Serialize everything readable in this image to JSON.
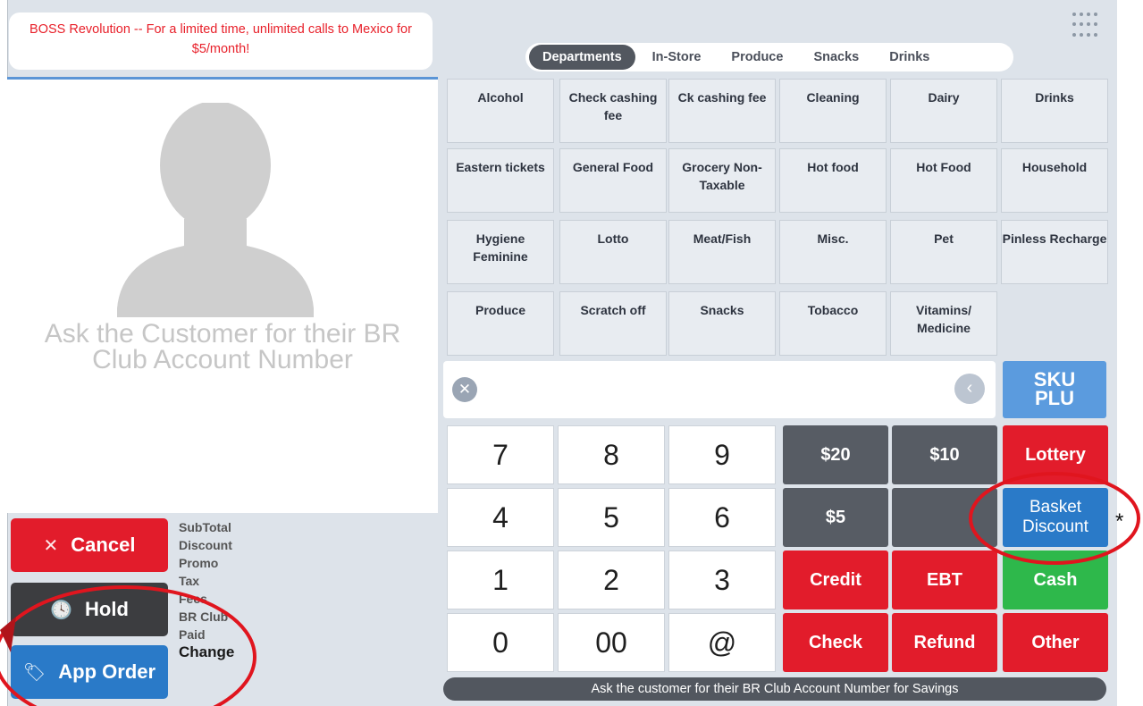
{
  "promo": {
    "text": "BOSS Revolution -- For a limited time, unlimited calls to Mexico for $5/month!"
  },
  "customer": {
    "prompt": "Ask the Customer for their BR Club Account Number"
  },
  "left_actions": {
    "cancel": "Cancel",
    "hold": "Hold",
    "app_order": "App Order"
  },
  "totals": {
    "labels": [
      "SubTotal",
      "Discount",
      "Promo",
      "Tax",
      "Fees",
      "BR Club",
      "Paid",
      "Change"
    ]
  },
  "tabs": [
    "Departments",
    "In-Store",
    "Produce",
    "Snacks",
    "Drinks"
  ],
  "departments": [
    "Alcohol",
    "Check cashing fee",
    "Ck cashing fee",
    "Cleaning",
    "Dairy",
    "Drinks",
    "Eastern tickets",
    "General Food",
    "Grocery Non-Taxable",
    "Hot food",
    "Hot Food",
    "Household",
    "Hygiene Feminine",
    "Lotto",
    "Meat/Fish",
    "Misc.",
    "Pet",
    "Pinless Recharge",
    "Produce",
    "Scratch off",
    "Snacks",
    "Tobacco",
    "Vitamins/ Medicine"
  ],
  "sku_button": {
    "line1": "SKU",
    "line2": "PLU"
  },
  "keypad": [
    "7",
    "8",
    "9",
    "4",
    "5",
    "6",
    "1",
    "2",
    "3",
    "0",
    "00",
    "@"
  ],
  "quick_cash": {
    "twenty": "$20",
    "ten": "$10",
    "five": "$5"
  },
  "payments": {
    "lottery": "Lottery",
    "basket_discount": "Basket Discount",
    "credit": "Credit",
    "ebt": "EBT",
    "cash": "Cash",
    "check": "Check",
    "refund": "Refund",
    "other": "Other"
  },
  "status_bar": "Ask the customer for their BR Club Account Number for Savings",
  "annotation": {
    "asterisk": "*"
  },
  "colors": {
    "red": "#e21c2b",
    "blue": "#2a7ac8",
    "green": "#2eb84b",
    "dark": "#52575f"
  }
}
